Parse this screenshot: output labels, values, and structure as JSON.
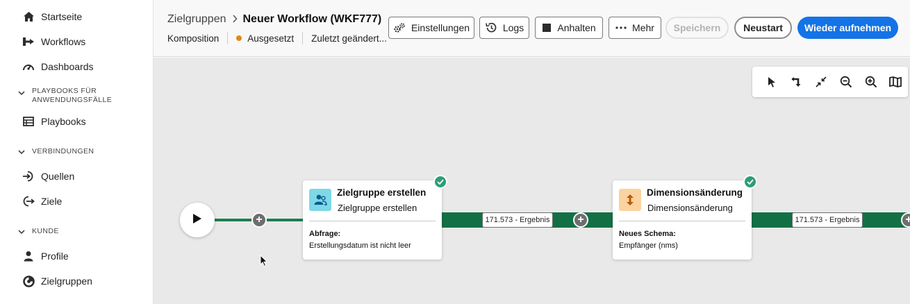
{
  "sidebar": {
    "items_top": [
      {
        "label": "Startseite",
        "icon": "home-icon"
      },
      {
        "label": "Workflows",
        "icon": "workflow-icon"
      },
      {
        "label": "Dashboards",
        "icon": "gauge-icon"
      }
    ],
    "section_playbooks": {
      "line1": "PLAYBOOKS FÜR",
      "line2": "ANWENDUNGSFÄLLE"
    },
    "playbooks": {
      "label": "Playbooks",
      "icon": "table-icon"
    },
    "section_connections": "VERBINDUNGEN",
    "sources": {
      "label": "Quellen",
      "icon": "import-icon"
    },
    "destinations": {
      "label": "Ziele",
      "icon": "export-icon"
    },
    "section_customer": "KUNDE",
    "profiles": {
      "label": "Profile",
      "icon": "user-icon"
    },
    "audiences": {
      "label": "Zielgruppen",
      "icon": "audience-icon"
    }
  },
  "header": {
    "breadcrumb_parent": "Zielgruppen",
    "title": "Neuer Workflow (WKF777)",
    "type": "Komposition",
    "status": "Ausgesetzt",
    "status_color": "#e68619",
    "modified": "Zuletzt geändert..."
  },
  "actions": {
    "settings": "Einstellungen",
    "logs": "Logs",
    "stop": "Anhalten",
    "more": "Mehr",
    "save": "Speichern",
    "restart": "Neustart",
    "resume": "Wieder aufnehmen"
  },
  "canvas": {
    "nodes": [
      {
        "title": "Zielgruppe erstellen",
        "subtitle": "Zielgruppe erstellen",
        "field_label": "Abfrage:",
        "field_value": "Erstellungsdatum ist nicht leer",
        "result": "171.573 - Ergebnis"
      },
      {
        "title": "Dimensionsänderung",
        "subtitle": "Dimensionsänderung",
        "field_label": "Neues Schema:",
        "field_value": "Empfänger (nms)",
        "result": "171.573 - Ergebnis"
      }
    ],
    "accent": "#137045",
    "primary": "#1473e6"
  }
}
